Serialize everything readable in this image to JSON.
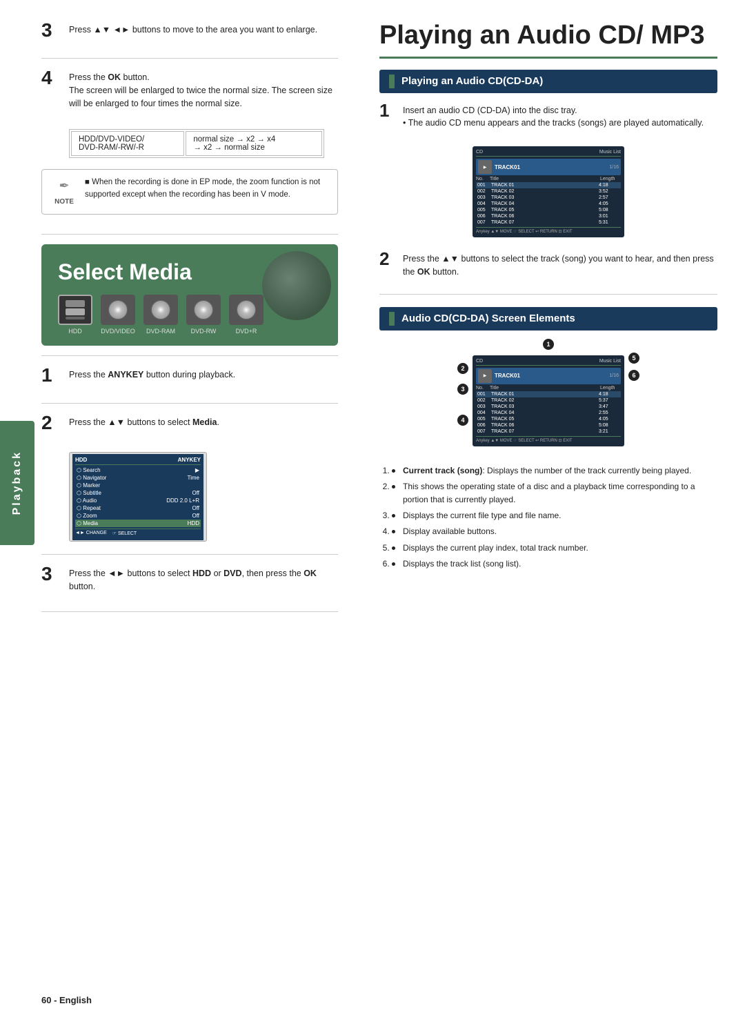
{
  "left": {
    "step3_top": {
      "num": "3",
      "text": "Press ▲▼ ◄► buttons to move to the area you want to enlarge."
    },
    "step4_top": {
      "num": "4",
      "text_prefix": "Press the ",
      "text_bold": "OK",
      "text_suffix": " button.",
      "description": "The screen will be enlarged to twice the normal size. The screen size will be enlarged to four times the normal size."
    },
    "zoom_table": {
      "col1_row1": "HDD/DVD-VIDEO/",
      "col1_row2": "DVD-RAM/-RW/-R",
      "col2_row1": "normal size → x2 → x4",
      "col2_row2": "→ x2 → normal size"
    },
    "note": {
      "label": "NOTE",
      "bullet": "When the recording is done in EP mode, the zoom function is not supported except when the recording has been in V mode."
    },
    "select_media": {
      "title": "Select Media",
      "icons": [
        {
          "label": "HDD",
          "selected": true
        },
        {
          "label": "DVD/VIDEO"
        },
        {
          "label": "DVD-RAM"
        },
        {
          "label": "DVD-RW"
        },
        {
          "label": "DVD+R"
        }
      ]
    },
    "playback_label": "Playback",
    "step1": {
      "num": "1",
      "text_prefix": "Press the ",
      "text_bold": "ANYKEY",
      "text_suffix": " button during playback."
    },
    "step2": {
      "num": "2",
      "text_prefix": "Press the ▲▼ buttons to select ",
      "text_bold": "Media",
      "text_suffix": "."
    },
    "anykey_menu": {
      "header_left": "HDD",
      "header_right": "ANYKEY",
      "rows": [
        {
          "label": "Search",
          "value": ""
        },
        {
          "label": "Navigator",
          "value": "Time"
        },
        {
          "label": "Marker",
          "value": ""
        },
        {
          "label": "Subtitle",
          "value": "Off"
        },
        {
          "label": "Audio",
          "value": "DDD 2.0 L+R"
        },
        {
          "label": "Repeat",
          "value": "Off"
        },
        {
          "label": "Zoom",
          "value": "Off"
        },
        {
          "label": "Media",
          "value": "HDD",
          "highlighted": true
        }
      ],
      "footer_change": "◄► CHANGE",
      "footer_select": "☞ SELECT"
    },
    "step3": {
      "num": "3",
      "text_prefix": "Press the ◄► buttons to select ",
      "text_bold1": "HDD",
      "text_mid": " or ",
      "text_bold2": "DVD",
      "text_suffix": ", then press the ",
      "text_bold3": "OK",
      "text_end": " button."
    },
    "footer": "60 - English"
  },
  "right": {
    "main_title": "Playing an Audio CD/ MP3",
    "section1": {
      "title": "Playing an Audio CD(CD-DA)",
      "step1": {
        "num": "1",
        "text": "Insert an audio CD (CD-DA) into the disc tray.",
        "bullet": "The audio CD menu appears and the tracks (songs) are played automatically."
      },
      "step2": {
        "num": "2",
        "text_prefix": "Press the ▲▼ buttons to select the track (song) you want to hear, and then press the ",
        "text_bold": "OK",
        "text_suffix": " button."
      },
      "music_list": {
        "header_left": "CD",
        "header_right": "Music List",
        "track_index": "1/16",
        "playing_track": "TRACK01",
        "columns": [
          "No.",
          "Title",
          "Length"
        ],
        "rows": [
          {
            "no": "001",
            "title": "TRACK 01",
            "length": "4:18"
          },
          {
            "no": "002",
            "title": "TRACK 02",
            "length": "3:52"
          },
          {
            "no": "003",
            "title": "TRACK 03",
            "length": "2:57"
          },
          {
            "no": "004",
            "title": "TRACK 04",
            "length": "4:05"
          },
          {
            "no": "005",
            "title": "TRACK 05",
            "length": "5:08"
          },
          {
            "no": "006",
            "title": "TRACK 06",
            "length": "3:01"
          },
          {
            "no": "007",
            "title": "TRACK 07",
            "length": "5:31"
          }
        ],
        "footer": "Anykey  ▲▼ MOVE  ☞ SELECT  ↩ RETURN  ⊡ EXIT"
      }
    },
    "section2": {
      "title": "Audio CD(CD-DA) Screen Elements",
      "annotations": {
        "1": "Current track (song)",
        "2": "",
        "3": "",
        "4": "",
        "5": "",
        "6": ""
      },
      "music_list2": {
        "header_left": "CD",
        "header_right": "Music List",
        "track_index": "1/16",
        "playing_track": "TRACK01",
        "columns": [
          "No.",
          "Title",
          "Length"
        ],
        "rows": [
          {
            "no": "001",
            "title": "TRACK 01",
            "length": "4:18"
          },
          {
            "no": "002",
            "title": "TRACK 02",
            "length": "5:37"
          },
          {
            "no": "003",
            "title": "TRACK 03",
            "length": "3:47"
          },
          {
            "no": "004",
            "title": "TRACK 04",
            "length": "2:55"
          },
          {
            "no": "005",
            "title": "TRACK 05",
            "length": "4:05"
          },
          {
            "no": "006",
            "title": "TRACK 06",
            "length": "5:08"
          },
          {
            "no": "007",
            "title": "TRACK 07",
            "length": "3:21"
          }
        ],
        "footer": "Anykey  ▲▼ MOVE  ☞ SELECT  ↩ RETURN  ⊡ EXIT"
      },
      "descriptions": [
        {
          "num": "1",
          "bold": "Current track (song)",
          "text": ": Displays the number of the track currently being played."
        },
        {
          "num": "2",
          "bold": null,
          "text": "This shows the operating state of a disc and a playback time corresponding to a portion that is currently played."
        },
        {
          "num": "3",
          "bold": null,
          "text": "Displays the current file type and file name."
        },
        {
          "num": "4",
          "bold": null,
          "text": "Display available buttons."
        },
        {
          "num": "5",
          "bold": null,
          "text": "Displays the current play index, total track number."
        },
        {
          "num": "6",
          "bold": null,
          "text": "Displays the track list (song list)."
        }
      ]
    }
  }
}
